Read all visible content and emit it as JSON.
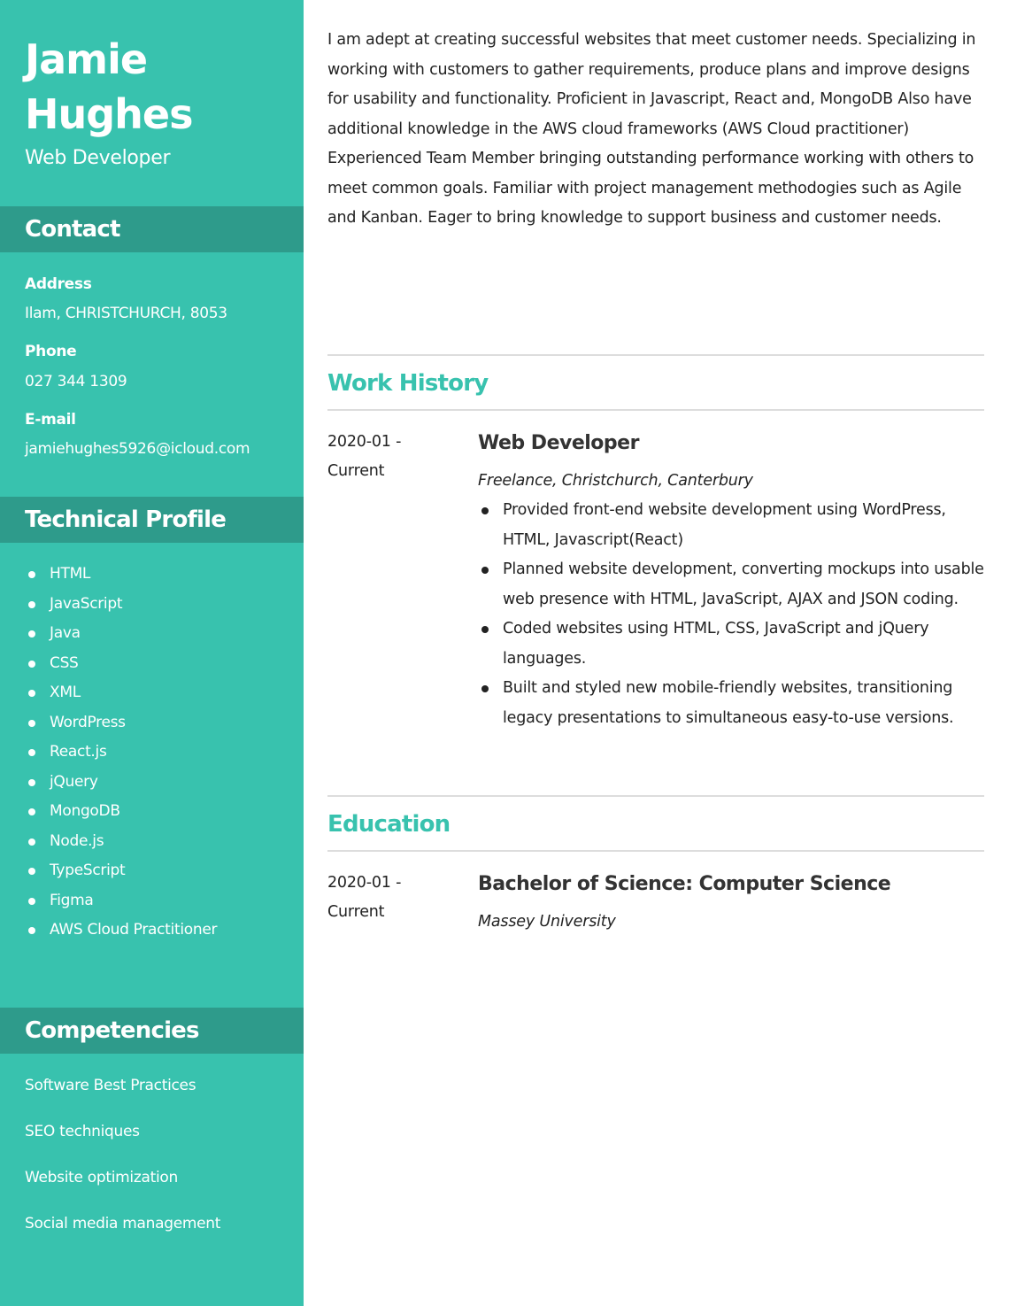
{
  "header": {
    "name_first": "Jamie",
    "name_last": "Hughes",
    "title": "Web Developer"
  },
  "contact": {
    "heading": "Contact",
    "address_label": "Address",
    "address_value": "Ilam, CHRISTCHURCH, 8053",
    "phone_label": "Phone",
    "phone_value": "027 344 1309",
    "email_label": "E-mail",
    "email_value": "jamiehughes5926@icloud.com"
  },
  "technical_profile": {
    "heading": "Technical Profile",
    "items": [
      "HTML",
      "JavaScript",
      "Java",
      "CSS",
      "XML",
      "WordPress",
      "React.js",
      "jQuery",
      "MongoDB",
      "Node.js",
      "TypeScript",
      "Figma",
      "AWS Cloud Practitioner"
    ]
  },
  "competencies": {
    "heading": "Competencies",
    "items": [
      "Software Best Practices",
      "SEO techniques",
      "Website optimization",
      "Social media management"
    ]
  },
  "summary": {
    "paragraph_1": "I am adept at creating successful websites that meet customer needs. Specializing in working with customers to gather requirements, produce plans and improve designs for usability and functionality. Proficient in Javascript, React and, MongoDB Also have additional knowledge in the AWS cloud frameworks (AWS Cloud practitioner)",
    "paragraph_2": "Experienced Team Member bringing outstanding performance working with others to meet common goals. Familiar with project management methodogies such as Agile and Kanban. Eager to bring knowledge to support business and customer needs."
  },
  "work_history": {
    "heading": "Work History",
    "date_start": "2020-01 -",
    "date_end": "Current",
    "title": "Web Developer",
    "org": "Freelance, Christchurch, Canterbury",
    "bullets": [
      "Provided front-end website development using WordPress, HTML, Javascript(React)",
      "Planned website development, converting mockups into usable web presence with HTML, JavaScript, AJAX and JSON coding.",
      "Coded websites using HTML, CSS, JavaScript and jQuery languages.",
      "Built and styled new mobile-friendly websites, transitioning legacy presentations to simultaneous easy-to-use versions."
    ]
  },
  "education": {
    "heading": "Education",
    "date_start": "2020-01 -",
    "date_end": "Current",
    "title": "Bachelor of Science: Computer Science",
    "org": "Massey University"
  },
  "colors": {
    "sidebar": "#38c2ae",
    "sidebar_heading": "#2e9b8b",
    "accent": "#38c2ae",
    "rule": "#dddddd"
  }
}
